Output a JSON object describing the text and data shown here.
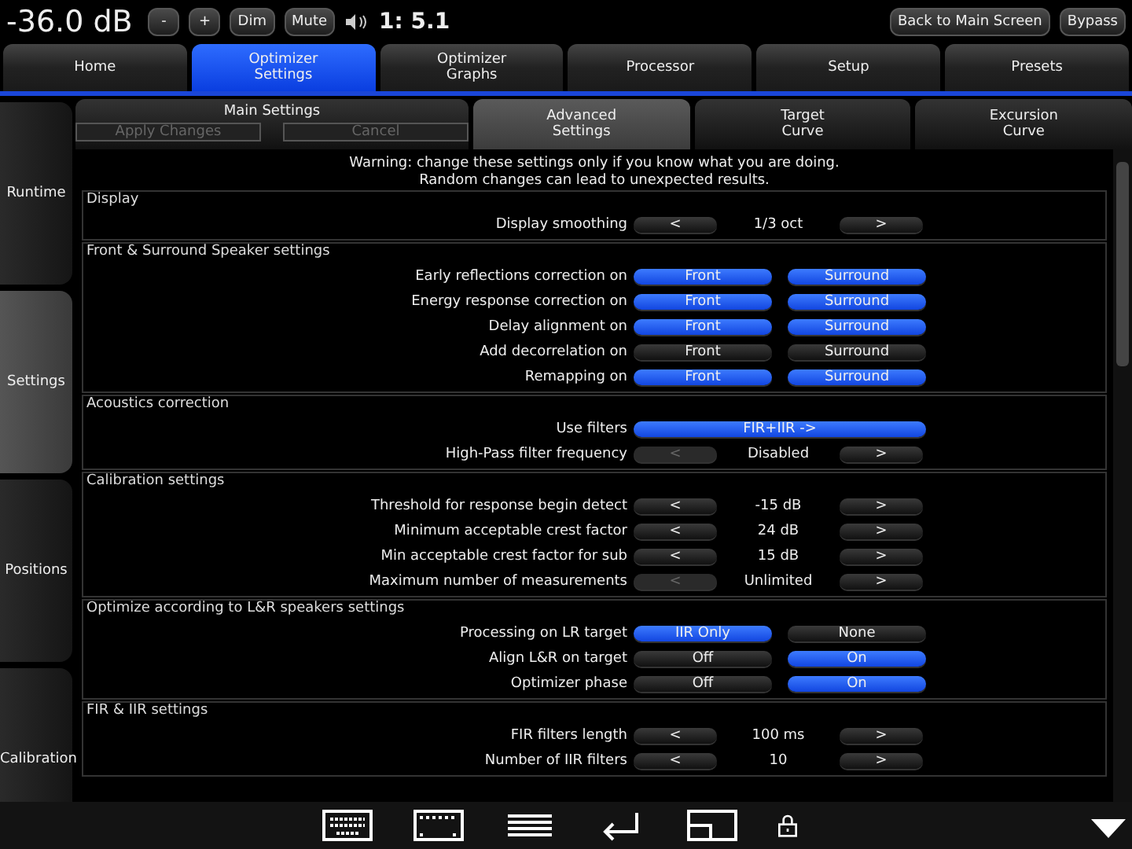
{
  "top_bar": {
    "volume": "-36.0 dB",
    "buttons": [
      {
        "label": "-",
        "kind": "small"
      },
      {
        "label": "+",
        "kind": "small"
      },
      {
        "label": "Dim",
        "kind": "small"
      },
      {
        "label": "Mute",
        "kind": "small"
      }
    ],
    "format": "1: 5.1",
    "right_buttons": [
      "Back to Main Screen",
      "Bypass"
    ]
  },
  "tabs": [
    {
      "label": "Home",
      "selected": false
    },
    {
      "label": "Optimizer\nSettings",
      "selected": true
    },
    {
      "label": "Optimizer\nGraphs",
      "selected": false
    },
    {
      "label": "Processor",
      "selected": false
    },
    {
      "label": "Setup",
      "selected": false
    },
    {
      "label": "Presets",
      "selected": false
    }
  ],
  "side_tabs": [
    {
      "label": "Runtime",
      "selected": false
    },
    {
      "label": "Settings",
      "selected": true
    },
    {
      "label": "Positions",
      "selected": false
    },
    {
      "label": "Calibration",
      "selected": false
    }
  ],
  "sub_tabs": [
    {
      "label": "Main Settings",
      "selected": false,
      "actions": [
        {
          "label": "Apply Changes",
          "disabled": true
        },
        {
          "label": "Cancel",
          "disabled": true
        }
      ]
    },
    {
      "label": "Advanced\nSettings",
      "selected": true
    },
    {
      "label": "Target\nCurve",
      "selected": false
    },
    {
      "label": "Excursion\nCurve",
      "selected": false
    }
  ],
  "warning": [
    "Warning: change these settings only if you know what you are doing.",
    "Random changes can lead to unexpected results."
  ],
  "sections": [
    {
      "title": "Display",
      "rows": [
        {
          "kind": "stepper",
          "label": "Display smoothing",
          "value": "1/3 oct",
          "prev_disabled": false
        }
      ]
    },
    {
      "title": "Front & Surround Speaker settings",
      "rows": [
        {
          "kind": "pair",
          "label": "Early reflections correction on",
          "options": [
            {
              "label": "Front",
              "selected": true
            },
            {
              "label": "Surround",
              "selected": true
            }
          ]
        },
        {
          "kind": "pair",
          "label": "Energy response correction on",
          "options": [
            {
              "label": "Front",
              "selected": true
            },
            {
              "label": "Surround",
              "selected": true
            }
          ]
        },
        {
          "kind": "pair",
          "label": "Delay alignment on",
          "options": [
            {
              "label": "Front",
              "selected": true
            },
            {
              "label": "Surround",
              "selected": true
            }
          ]
        },
        {
          "kind": "pair",
          "label": "Add decorrelation on",
          "options": [
            {
              "label": "Front",
              "selected": false
            },
            {
              "label": "Surround",
              "selected": false
            }
          ]
        },
        {
          "kind": "pair",
          "label": "Remapping on",
          "options": [
            {
              "label": "Front",
              "selected": true
            },
            {
              "label": "Surround",
              "selected": true
            }
          ]
        }
      ]
    },
    {
      "title": "Acoustics correction",
      "rows": [
        {
          "kind": "wide",
          "label": "Use filters",
          "value": "FIR+IIR ->"
        },
        {
          "kind": "stepper",
          "label": "High-Pass filter frequency",
          "value": "Disabled",
          "prev_disabled": true
        }
      ]
    },
    {
      "title": "Calibration settings",
      "rows": [
        {
          "kind": "stepper",
          "label": "Threshold for response begin detect",
          "value": "-15 dB",
          "prev_disabled": false
        },
        {
          "kind": "stepper",
          "label": "Minimum acceptable crest factor",
          "value": "24 dB",
          "prev_disabled": false
        },
        {
          "kind": "stepper",
          "label": "Min acceptable crest factor for sub",
          "value": "15 dB",
          "prev_disabled": false
        },
        {
          "kind": "stepper",
          "label": "Maximum number of measurements",
          "value": "Unlimited",
          "prev_disabled": true
        }
      ]
    },
    {
      "title": "Optimize according to L&R speakers settings",
      "rows": [
        {
          "kind": "pair",
          "label": "Processing on LR target",
          "options": [
            {
              "label": "IIR Only",
              "selected": true
            },
            {
              "label": "None",
              "selected": false
            }
          ]
        },
        {
          "kind": "pair",
          "label": "Align L&R on target",
          "options": [
            {
              "label": "Off",
              "selected": false
            },
            {
              "label": "On",
              "selected": true
            }
          ]
        },
        {
          "kind": "pair",
          "label": "Optimizer phase",
          "options": [
            {
              "label": "Off",
              "selected": false
            },
            {
              "label": "On",
              "selected": true
            }
          ]
        }
      ]
    },
    {
      "title": "FIR & IIR settings",
      "rows": [
        {
          "kind": "stepper",
          "label": "FIR filters length",
          "value": "100 ms",
          "prev_disabled": false
        },
        {
          "kind": "stepper",
          "label": "Number of IIR filters",
          "value": "10",
          "prev_disabled": false
        }
      ]
    }
  ],
  "step_labels": {
    "prev": "<",
    "next": ">"
  }
}
